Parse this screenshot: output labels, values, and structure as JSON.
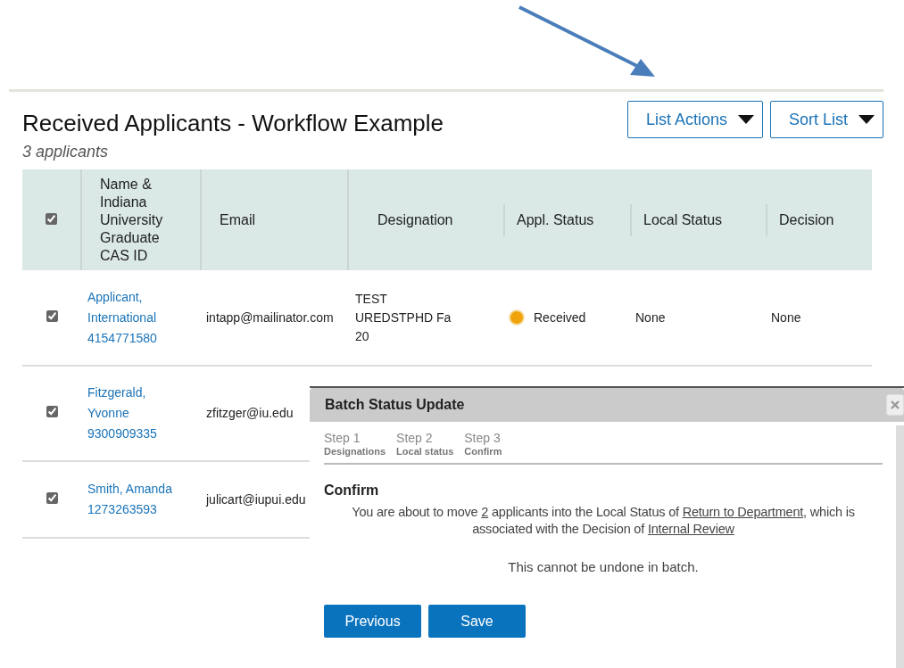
{
  "heading": {
    "title": "Received Applicants - Workflow Example",
    "count": "3 applicants"
  },
  "actions": [
    {
      "label": "List Actions"
    },
    {
      "label": "Sort List"
    }
  ],
  "table": {
    "select_all": {
      "checked": true
    },
    "columns": [
      "Name & Indiana University Graduate CAS ID",
      "Email",
      "Designation",
      "Appl. Status",
      "Local Status",
      "Decision"
    ],
    "rows": [
      {
        "checked": true,
        "name": "Applicant, International",
        "cas_id": "4154771580",
        "email": "intapp@mailinator.com",
        "designation": "TEST UREDSTPHD Fa 20",
        "appl_status": {
          "label": "Received",
          "color": "#f0a30a"
        },
        "local_status": "None",
        "decision": "None"
      },
      {
        "checked": true,
        "name": "Fitzgerald, Yvonne",
        "cas_id": "9300909335",
        "email": "zfitzger@iu.edu"
      },
      {
        "checked": true,
        "name": "Smith, Amanda",
        "cas_id": "1273263593",
        "email": "julicart@iupui.edu"
      }
    ]
  },
  "dialog": {
    "title": "Batch Status Update",
    "steps": [
      {
        "label": "Step 1",
        "caption": "Designations"
      },
      {
        "label": "Step 2",
        "caption": "Local status"
      },
      {
        "label": "Step 3",
        "caption": "Confirm"
      }
    ],
    "section": "Confirm",
    "message": [
      {
        "kind": "text",
        "text": "You are about to move "
      },
      {
        "kind": "link",
        "text": "2"
      },
      {
        "kind": "text",
        "text": " applicants into the Local Status of "
      },
      {
        "kind": "link",
        "text": "Return to Department"
      },
      {
        "kind": "text",
        "text": ", which is associated with the Decision of "
      },
      {
        "kind": "link",
        "text": "Internal Review"
      }
    ],
    "note": "This cannot be undone in batch.",
    "buttons": [
      {
        "label": "Previous"
      },
      {
        "label": "Save"
      }
    ]
  }
}
